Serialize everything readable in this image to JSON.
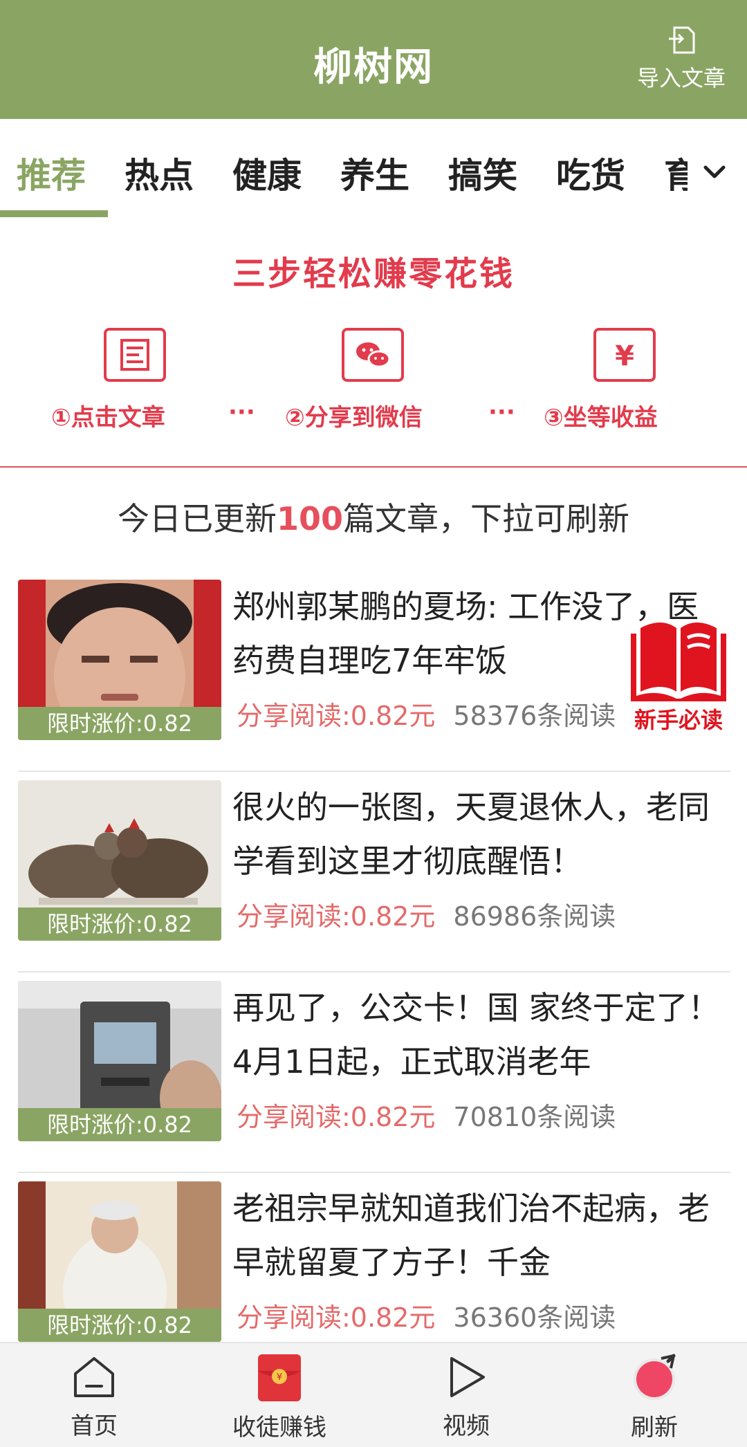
{
  "header": {
    "title": "柳树网",
    "import_label": "导入文章"
  },
  "tabs": {
    "items": [
      "推荐",
      "热点",
      "健康",
      "养生",
      "搞笑",
      "吃货"
    ],
    "clipped": "育",
    "active_index": 0
  },
  "banner": {
    "title": "三步轻松赚零花钱",
    "steps": [
      "①点击文章",
      "②分享到微信",
      "③坐等收益"
    ],
    "dots": "···",
    "yen_symbol": "¥"
  },
  "update": {
    "prefix": "今日已更新",
    "count": "100",
    "suffix": "篇文章，下拉可刷新"
  },
  "articles": [
    {
      "title": "郑州郭某鹏的夏场: 工作没了，医药费自理吃7年牢饭",
      "badge": "限时涨价:0.82",
      "price": "分享阅读:0.82元",
      "reads": "58376条阅读"
    },
    {
      "title": "很火的一张图，天夏退休人，老同学看到这里才彻底醒悟！",
      "badge": "限时涨价:0.82",
      "price": "分享阅读:0.82元",
      "reads": "86986条阅读"
    },
    {
      "title": "再见了，公交卡！国 家终于定了！4月1日起，正式取消老年",
      "badge": "限时涨价:0.82",
      "price": "分享阅读:0.82元",
      "reads": "70810条阅读"
    },
    {
      "title": "老祖宗早就知道我们治不起病，老早就留夏了方子！千金",
      "badge": "限时涨价:0.82",
      "price": "分享阅读:0.82元",
      "reads": "36360条阅读"
    }
  ],
  "newbie": {
    "label": "新手必读"
  },
  "bottom_nav": {
    "items": [
      "首页",
      "收徒赚钱",
      "视频",
      "刷新"
    ]
  },
  "colors": {
    "brand_green": "#8aa563",
    "accent_red": "#e23b4c",
    "price_red": "#e46a6a"
  }
}
